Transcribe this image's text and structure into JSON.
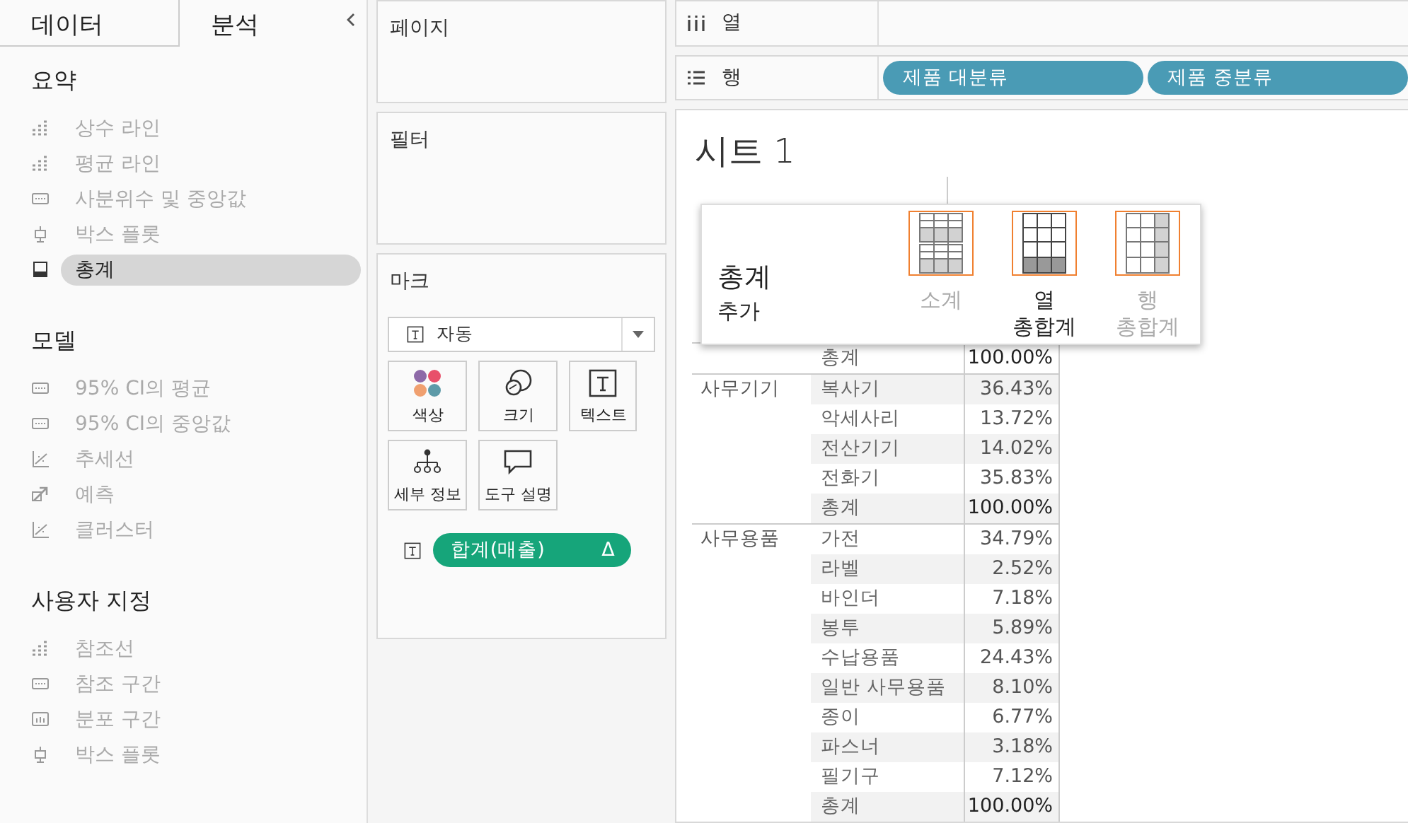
{
  "sidebar": {
    "tabs": [
      {
        "label": "데이터",
        "selected": false
      },
      {
        "label": "분석",
        "selected": true
      }
    ],
    "sections": [
      {
        "title": "요약",
        "items": [
          {
            "label": "상수 라인",
            "kind": "line",
            "disabled": true,
            "selected": false
          },
          {
            "label": "평균 라인",
            "kind": "line",
            "disabled": true,
            "selected": false
          },
          {
            "label": "사분위수 및 중앙값",
            "kind": "band",
            "disabled": true,
            "selected": false
          },
          {
            "label": "박스 플롯",
            "kind": "box",
            "disabled": true,
            "selected": false
          },
          {
            "label": "총계",
            "kind": "total",
            "disabled": false,
            "selected": true
          }
        ]
      },
      {
        "title": "모델",
        "items": [
          {
            "label": "95% CI의 평균",
            "kind": "band",
            "disabled": true,
            "selected": false
          },
          {
            "label": "95% CI의 중앙값",
            "kind": "band",
            "disabled": true,
            "selected": false
          },
          {
            "label": "추세선",
            "kind": "trend",
            "disabled": true,
            "selected": false
          },
          {
            "label": "예측",
            "kind": "forecast",
            "disabled": true,
            "selected": false
          },
          {
            "label": "클러스터",
            "kind": "trend",
            "disabled": true,
            "selected": false
          }
        ]
      },
      {
        "title": "사용자 지정",
        "items": [
          {
            "label": "참조선",
            "kind": "line",
            "disabled": true,
            "selected": false
          },
          {
            "label": "참조 구간",
            "kind": "band",
            "disabled": true,
            "selected": false
          },
          {
            "label": "분포 구간",
            "kind": "distribution",
            "disabled": true,
            "selected": false
          },
          {
            "label": "박스 플롯",
            "kind": "box",
            "disabled": true,
            "selected": false
          }
        ]
      }
    ]
  },
  "pages": {
    "title": "페이지"
  },
  "filters": {
    "title": "필터"
  },
  "marks": {
    "title": "마크",
    "mark_type": "자동",
    "buttons": [
      {
        "label": "색상",
        "kind": "color"
      },
      {
        "label": "크기",
        "kind": "size"
      },
      {
        "label": "텍스트",
        "kind": "text"
      },
      {
        "label": "세부 정보",
        "kind": "detail"
      },
      {
        "label": "도구 설명",
        "kind": "tooltip"
      }
    ],
    "fields": [
      {
        "label": "합계(매출)",
        "delta": "Δ"
      }
    ]
  },
  "shelves": [
    {
      "label": "열",
      "kind": "columns"
    },
    {
      "label": "행",
      "kind": "rows",
      "pills": [
        "제품 대분류",
        "제품 중분류"
      ]
    }
  ],
  "sheet": {
    "title": "시트 1",
    "groups": [
      {
        "rows": [
          {
            "label": "총계",
            "value": "100.00%",
            "kind": "total"
          }
        ]
      },
      {
        "name": "사무기기",
        "rows": [
          {
            "label": "복사기",
            "value": "36.43%",
            "kind": "item"
          },
          {
            "label": "악세사리",
            "value": "13.72%",
            "kind": "item"
          },
          {
            "label": "전산기기",
            "value": "14.02%",
            "kind": "item"
          },
          {
            "label": "전화기",
            "value": "35.83%",
            "kind": "item"
          },
          {
            "label": "총계",
            "value": "100.00%",
            "kind": "total"
          }
        ]
      },
      {
        "name": "사무용품",
        "rows": [
          {
            "label": "가전",
            "value": "34.79%",
            "kind": "item"
          },
          {
            "label": "라벨",
            "value": "2.52%",
            "kind": "item"
          },
          {
            "label": "바인더",
            "value": "7.18%",
            "kind": "item"
          },
          {
            "label": "봉투",
            "value": "5.89%",
            "kind": "item"
          },
          {
            "label": "수납용품",
            "value": "24.43%",
            "kind": "item"
          },
          {
            "label": "일반 사무용품",
            "value": "8.10%",
            "kind": "item"
          },
          {
            "label": "종이",
            "value": "6.77%",
            "kind": "item"
          },
          {
            "label": "파스너",
            "value": "3.18%",
            "kind": "item"
          },
          {
            "label": "필기구",
            "value": "7.12%",
            "kind": "item"
          },
          {
            "label": "총계",
            "value": "100.00%",
            "kind": "total"
          }
        ]
      }
    ]
  },
  "popup": {
    "title": "총계",
    "subtitle": "추가",
    "options": [
      {
        "lines": [
          "소계"
        ],
        "kind": "subtotals",
        "disabled": true
      },
      {
        "lines": [
          "열",
          "총합계"
        ],
        "kind": "column_totals",
        "disabled": false
      },
      {
        "lines": [
          "행",
          "총합계"
        ],
        "kind": "row_totals",
        "disabled": true
      }
    ]
  }
}
